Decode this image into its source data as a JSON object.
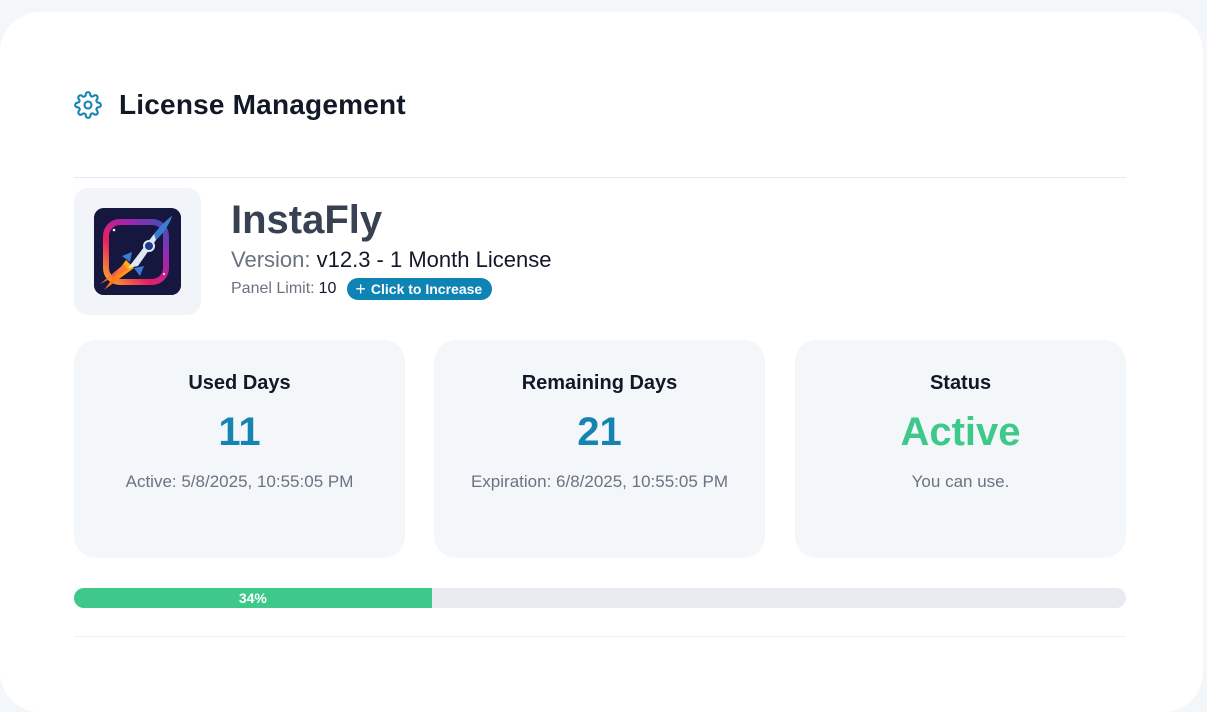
{
  "page": {
    "title": "License Management",
    "gear_icon": "gear-icon",
    "accent": "#1584b0"
  },
  "app": {
    "name": "InstaFly",
    "logo_icon": "rocket-app-logo",
    "version_label": "Version:",
    "version_value": "v12.3 - 1 Month License",
    "panel_limit_label": "Panel Limit:",
    "panel_limit_value": "10",
    "increase_button": {
      "icon": "plus-icon",
      "symbol": "+",
      "label": "Click to Increase"
    }
  },
  "stats": {
    "used": {
      "title": "Used Days",
      "value": "11",
      "sub": "Active: 5/8/2025, 10:55:05 PM"
    },
    "remaining": {
      "title": "Remaining Days",
      "value": "21",
      "sub": "Expiration: 6/8/2025, 10:55:05 PM"
    },
    "status": {
      "title": "Status",
      "value": "Active",
      "sub": "You can use.",
      "color": "#3ec98a"
    }
  },
  "progress": {
    "percent": 34,
    "label": "34%",
    "color": "#3ec98a"
  }
}
